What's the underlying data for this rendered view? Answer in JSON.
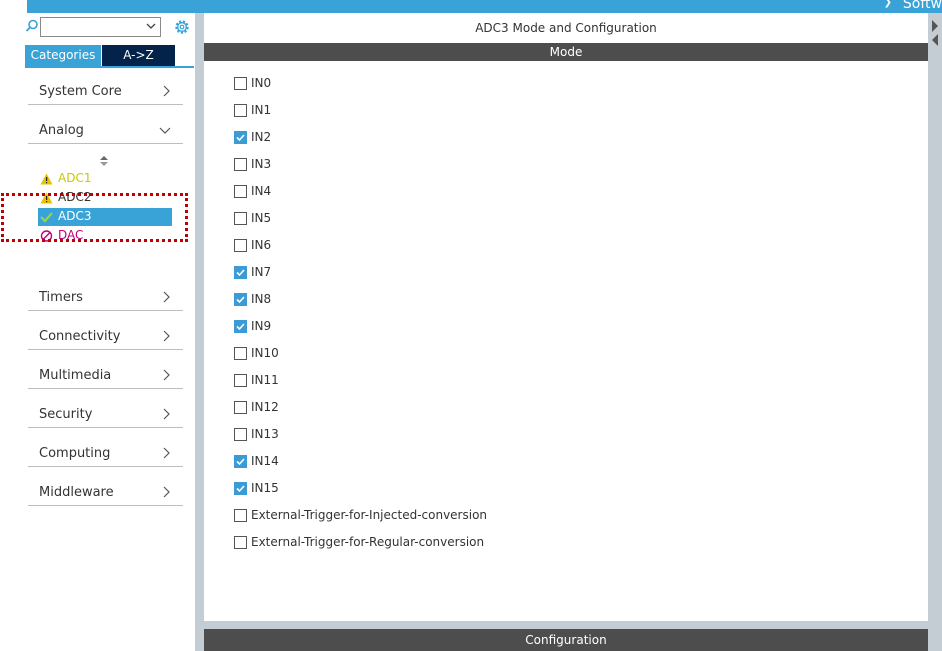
{
  "topbar": {
    "label": "Softw"
  },
  "sidebar": {
    "tabs": {
      "categories": "Categories",
      "az": "A->Z"
    },
    "categories": [
      {
        "label": "System Core",
        "expanded": false
      },
      {
        "label": "Analog",
        "expanded": true
      },
      {
        "label": "Timers",
        "expanded": false
      },
      {
        "label": "Connectivity",
        "expanded": false
      },
      {
        "label": "Multimedia",
        "expanded": false
      },
      {
        "label": "Security",
        "expanded": false
      },
      {
        "label": "Computing",
        "expanded": false
      },
      {
        "label": "Middleware",
        "expanded": false
      }
    ],
    "analog_items": [
      {
        "label": "ADC1",
        "status": "warning",
        "icon": "warning-icon",
        "color": "#c8c800"
      },
      {
        "label": "ADC2",
        "status": "warning",
        "icon": "warning-icon",
        "color": "#333333"
      },
      {
        "label": "ADC3",
        "status": "ok",
        "icon": "check-icon",
        "color": "#ffffff",
        "selected": true
      },
      {
        "label": "DAC",
        "status": "disabled",
        "icon": "no-entry-icon",
        "color": "#c0007a"
      }
    ]
  },
  "main": {
    "title": "ADC3 Mode and Configuration",
    "mode_header": "Mode",
    "config_header": "Configuration",
    "options": [
      {
        "label": "IN0",
        "checked": false
      },
      {
        "label": "IN1",
        "checked": false
      },
      {
        "label": "IN2",
        "checked": true
      },
      {
        "label": "IN3",
        "checked": false
      },
      {
        "label": "IN4",
        "checked": false
      },
      {
        "label": "IN5",
        "checked": false
      },
      {
        "label": "IN6",
        "checked": false
      },
      {
        "label": "IN7",
        "checked": true
      },
      {
        "label": "IN8",
        "checked": true
      },
      {
        "label": "IN9",
        "checked": true
      },
      {
        "label": "IN10",
        "checked": false
      },
      {
        "label": "IN11",
        "checked": false
      },
      {
        "label": "IN12",
        "checked": false
      },
      {
        "label": "IN13",
        "checked": false
      },
      {
        "label": "IN14",
        "checked": true
      },
      {
        "label": "IN15",
        "checked": true
      },
      {
        "label": "External-Trigger-for-Injected-conversion",
        "checked": false
      },
      {
        "label": "External-Trigger-for-Regular-conversion",
        "checked": false
      }
    ]
  },
  "colors": {
    "accent": "#39a3d8",
    "dark_tab": "#03234b",
    "header_bar": "#4d4d4d",
    "highlight_box": "#c00000"
  }
}
